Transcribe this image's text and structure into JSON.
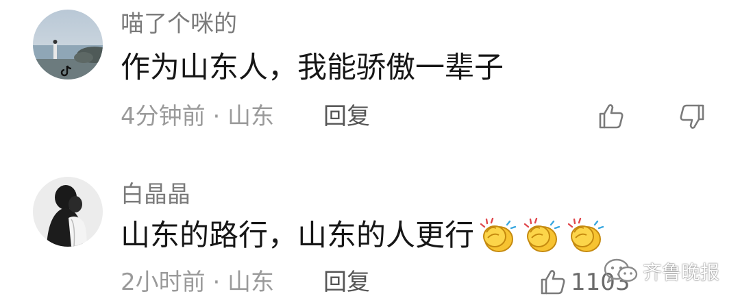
{
  "comments": [
    {
      "username": "喵了个咪的",
      "content": "作为山东人，我能骄傲一辈子",
      "meta": "4分钟前 · 山东",
      "reply_label": "回复",
      "like_icon": "thumbs-up-icon",
      "dislike_icon": "thumbs-down-icon"
    },
    {
      "username": "白晶晶",
      "content": "山东的路行，山东的人更行",
      "emoji_count": 3,
      "emoji_icon": "clapping-hands-icon",
      "meta": "2小时前 · 山东",
      "reply_label": "回复",
      "like_icon": "thumbs-up-icon",
      "like_count": "1103"
    }
  ],
  "watermark": {
    "text": "齐鲁晚报",
    "icon": "wechat-icon"
  }
}
